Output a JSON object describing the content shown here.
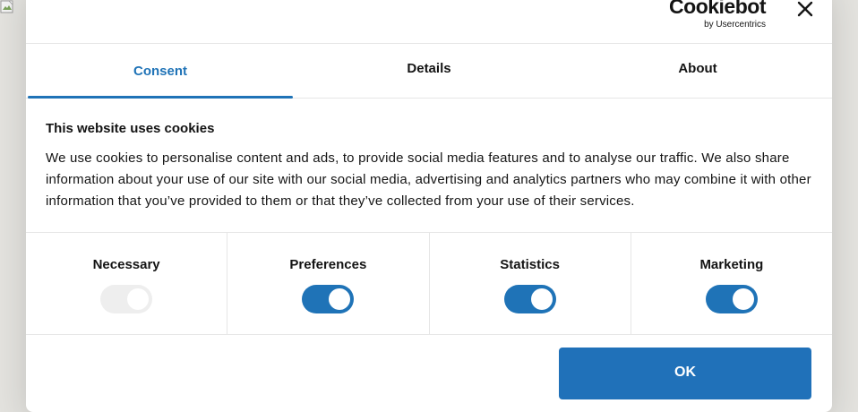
{
  "brand": {
    "logo_word": "Cookiebot",
    "logo_sub": "by Usercentrics"
  },
  "tabs": [
    {
      "label": "Consent",
      "active": true
    },
    {
      "label": "Details",
      "active": false
    },
    {
      "label": "About",
      "active": false
    }
  ],
  "content": {
    "heading": "This website uses cookies",
    "body": "We use cookies to personalise content and ads, to provide social media features and to analyse our traffic. We also share information about your use of our site with our social media, advertising and analytics partners who may combine it with other information that you’ve provided to them or that they’ve collected from your use of their services."
  },
  "categories": [
    {
      "label": "Necessary",
      "enabled": true,
      "locked": true
    },
    {
      "label": "Preferences",
      "enabled": true,
      "locked": false
    },
    {
      "label": "Statistics",
      "enabled": true,
      "locked": false
    },
    {
      "label": "Marketing",
      "enabled": true,
      "locked": false
    }
  ],
  "actions": {
    "ok_label": "OK"
  },
  "colors": {
    "accent": "#1f73b7",
    "button": "#2071b9",
    "backdrop": "#e4e3df"
  },
  "icons": [
    "broken-image-icon",
    "close-icon"
  ]
}
